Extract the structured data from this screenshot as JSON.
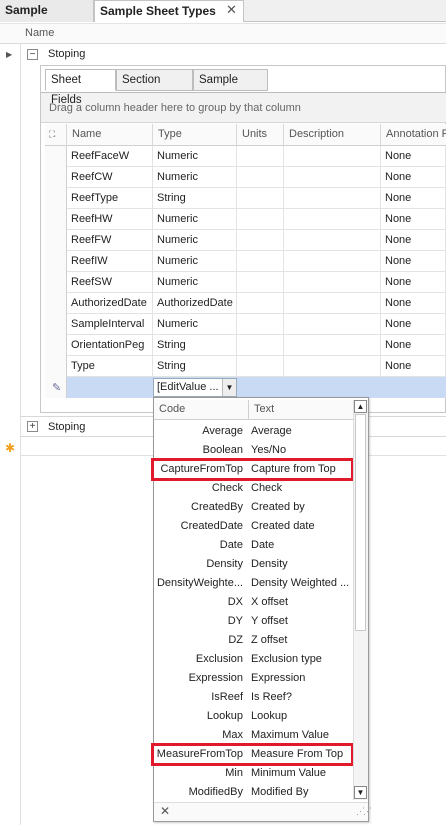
{
  "tabs": {
    "tab1": "Sample Sheets",
    "tab2": "Sample Sheet Types",
    "close": "✕"
  },
  "header": {
    "name": "Name"
  },
  "rows": {
    "row1": "Stoping",
    "row2": "Stoping"
  },
  "detail_tabs": [
    "Sheet Fields",
    "Section Fields",
    "Sample Fields"
  ],
  "group_panel": "Drag a column header here to group by that column",
  "columns": [
    "Name",
    "Type",
    "Units",
    "Description",
    "Annotation P"
  ],
  "fields": [
    {
      "name": "ReefFaceW",
      "type": "Numeric",
      "ann": "None"
    },
    {
      "name": "ReefCW",
      "type": "Numeric",
      "ann": "None"
    },
    {
      "name": "ReefType",
      "type": "String",
      "ann": "None"
    },
    {
      "name": "ReefHW",
      "type": "Numeric",
      "ann": "None"
    },
    {
      "name": "ReefFW",
      "type": "Numeric",
      "ann": "None"
    },
    {
      "name": "ReefIW",
      "type": "Numeric",
      "ann": "None"
    },
    {
      "name": "ReefSW",
      "type": "Numeric",
      "ann": "None"
    },
    {
      "name": "AuthorizedDate",
      "type": "AuthorizedDate",
      "ann": "None"
    },
    {
      "name": "SampleInterval",
      "type": "Numeric",
      "ann": "None"
    },
    {
      "name": "OrientationPeg",
      "type": "String",
      "ann": "None"
    },
    {
      "name": "Type",
      "type": "String",
      "ann": "None"
    }
  ],
  "edit_value": "[EditValue ...",
  "popup": {
    "col_code": "Code",
    "col_text": "Text",
    "items": [
      {
        "code": "Average",
        "text": "Average"
      },
      {
        "code": "Boolean",
        "text": "Yes/No"
      },
      {
        "code": "CaptureFromTop",
        "text": "Capture from Top"
      },
      {
        "code": "Check",
        "text": "Check"
      },
      {
        "code": "CreatedBy",
        "text": "Created by"
      },
      {
        "code": "CreatedDate",
        "text": "Created date"
      },
      {
        "code": "Date",
        "text": "Date"
      },
      {
        "code": "Density",
        "text": "Density"
      },
      {
        "code": "DensityWeighte...",
        "text": "Density Weighted ..."
      },
      {
        "code": "DX",
        "text": "X offset"
      },
      {
        "code": "DY",
        "text": "Y offset"
      },
      {
        "code": "DZ",
        "text": "Z offset"
      },
      {
        "code": "Exclusion",
        "text": "Exclusion type"
      },
      {
        "code": "Expression",
        "text": "Expression"
      },
      {
        "code": "IsReef",
        "text": "Is Reef?"
      },
      {
        "code": "Lookup",
        "text": "Lookup"
      },
      {
        "code": "Max",
        "text": "Maximum Value"
      },
      {
        "code": "MeasureFromTop",
        "text": "Measure From Top"
      },
      {
        "code": "Min",
        "text": "Minimum Value"
      },
      {
        "code": "ModifiedBy",
        "text": "Modified By"
      }
    ],
    "highlighted": [
      "CaptureFromTop",
      "MeasureFromTop"
    ],
    "close": "✕"
  },
  "colors": {
    "highlight_red": "#e0192b",
    "edit_row": "#c9dbf4"
  }
}
